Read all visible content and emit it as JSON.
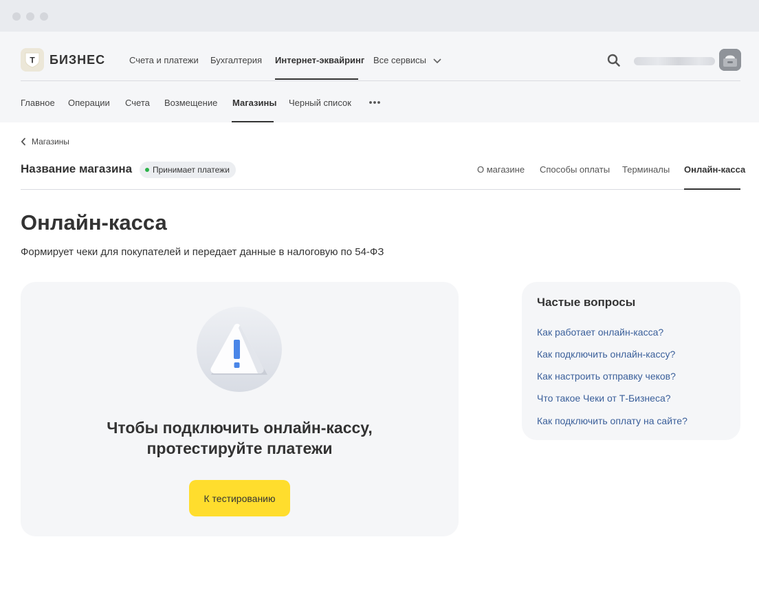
{
  "header": {
    "logo_text": "БИЗНЕС",
    "logo_letter": "Т",
    "main_nav": [
      {
        "label": "Счета и платежи"
      },
      {
        "label": "Бухгалтерия"
      },
      {
        "label": "Интернет-эквайринг",
        "active": true
      },
      {
        "label": "Все сервисы"
      }
    ]
  },
  "sub_nav": [
    {
      "label": "Главное"
    },
    {
      "label": "Операции"
    },
    {
      "label": "Счета"
    },
    {
      "label": "Возмещение"
    },
    {
      "label": "Магазины",
      "active": true
    },
    {
      "label": "Черный список"
    }
  ],
  "breadcrumb": {
    "label": "Магазины"
  },
  "store": {
    "name": "Название магазина",
    "status": "Принимает платежи",
    "tabs": [
      {
        "label": "О магазине"
      },
      {
        "label": "Способы оплаты"
      },
      {
        "label": "Терминалы"
      },
      {
        "label": "Онлайн-касса",
        "active": true
      }
    ]
  },
  "page": {
    "title": "Онлайн-касса",
    "description": "Формирует чеки для покупателей и передает данные в налоговую по 54-ФЗ"
  },
  "card": {
    "heading_line1": "Чтобы подключить онлайн-кассу,",
    "heading_line2": "протестируйте платежи",
    "button": "К тестированию"
  },
  "faq": {
    "title": "Частые вопросы",
    "links": [
      {
        "label": "Как работает онлайн-касса?"
      },
      {
        "label": "Как подключить онлайн-кассу?"
      },
      {
        "label": "Как настроить отправку чеков?"
      },
      {
        "label": "Что такое Чеки от Т-Бизнеса?"
      },
      {
        "label": "Как подключить оплату на сайте?"
      }
    ]
  },
  "colors": {
    "accent": "#ffdd2d",
    "link": "#3a5f9a",
    "status_ok": "#2cb34a",
    "panel_bg": "#f5f6f8"
  }
}
